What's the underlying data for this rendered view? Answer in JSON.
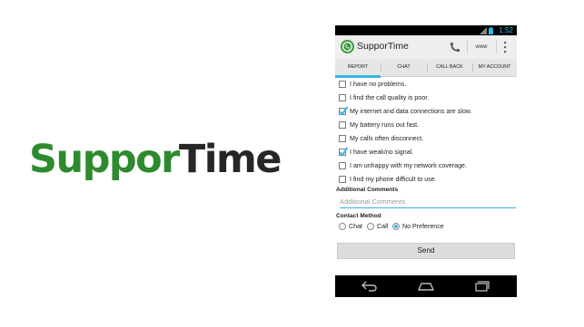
{
  "brand": {
    "wordmark_part1": "Suppor",
    "wordmark_part2": "Time",
    "colors": {
      "green": "#2e8a2e",
      "dark": "#262626"
    }
  },
  "status_bar": {
    "icons": [
      "signal-icon",
      "battery-icon"
    ],
    "time": "1:52",
    "time_color": "#33b5e5"
  },
  "action_bar": {
    "app_icon": "phone-circle-icon",
    "title": "SupporTime",
    "actions": [
      {
        "name": "phone-icon"
      },
      {
        "label": "www"
      },
      {
        "name": "overflow-menu-icon"
      }
    ]
  },
  "tabs": [
    {
      "label": "REPORT",
      "active": true
    },
    {
      "label": "CHAT",
      "active": false
    },
    {
      "label": "CALL BACK",
      "active": false
    },
    {
      "label": "MY ACCOUNT",
      "active": false
    }
  ],
  "problems": [
    {
      "label": "I have no problems.",
      "checked": false
    },
    {
      "label": "I find the call quality is poor.",
      "checked": false
    },
    {
      "label": "My internet and data connections are slow.",
      "checked": true
    },
    {
      "label": "My battery runs out fast.",
      "checked": false
    },
    {
      "label": "My calls often disconnect.",
      "checked": false
    },
    {
      "label": "I have weak/no signal.",
      "checked": true
    },
    {
      "label": "I am unhappy with my network coverage.",
      "checked": false
    },
    {
      "label": "I find my phone difficult to use.",
      "checked": false
    }
  ],
  "additional_comments": {
    "label": "Additional Comments",
    "placeholder": "Additional Comments",
    "value": ""
  },
  "contact_method": {
    "label": "Contact Method",
    "options": [
      {
        "label": "Chat",
        "selected": false
      },
      {
        "label": "Call",
        "selected": false
      },
      {
        "label": "No Preference",
        "selected": true
      }
    ]
  },
  "send_label": "Send",
  "nav_bar": [
    "back-icon",
    "home-icon",
    "recent-apps-icon"
  ],
  "accent_color": "#33b5e5"
}
